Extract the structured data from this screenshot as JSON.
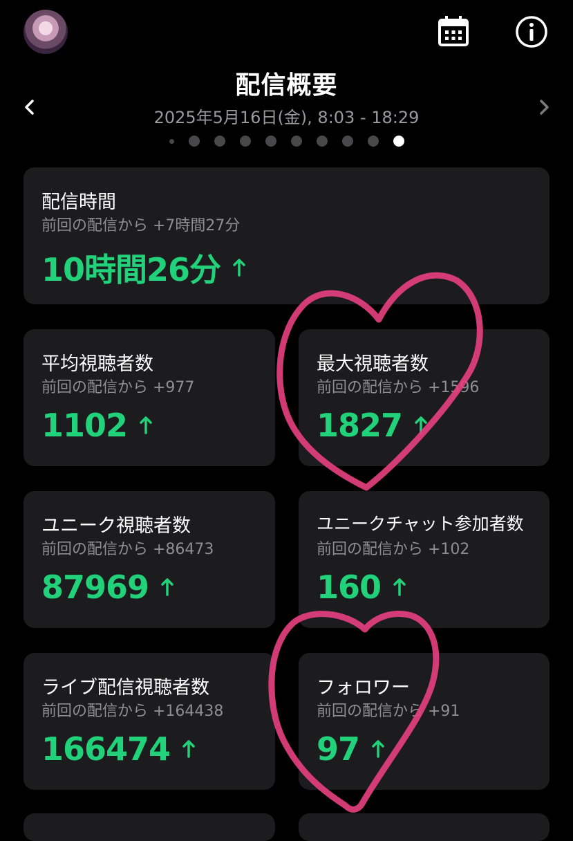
{
  "header": {
    "title": "配信概要",
    "date_range": "2025年5月16日(金), 8:03 - 18:29"
  },
  "icons": {
    "calendar": "calendar-icon",
    "info": "info-icon",
    "prev": "chevron-left-icon",
    "next": "chevron-right-icon",
    "trend": "arrow-up-icon"
  },
  "pager": {
    "count": 10,
    "active_index": 9
  },
  "colors": {
    "background": "#000000",
    "card": "#1c1c1e",
    "accent_green": "#22d27b",
    "annotation_pink": "#e8407f"
  },
  "cards": {
    "duration": {
      "label": "配信時間",
      "delta": "前回の配信から +7時間27分",
      "value": "10時間26分"
    },
    "avg_viewers": {
      "label": "平均視聴者数",
      "delta": "前回の配信から +977",
      "value": "1102"
    },
    "max_viewers": {
      "label": "最大視聴者数",
      "delta": "前回の配信から +1596",
      "value": "1827"
    },
    "unique_viewers": {
      "label": "ユニーク視聴者数",
      "delta": "前回の配信から +86473",
      "value": "87969"
    },
    "unique_chatters": {
      "label": "ユニークチャット参加者数",
      "delta": "前回の配信から +102",
      "value": "160"
    },
    "live_viewers": {
      "label": "ライブ配信視聴者数",
      "delta": "前回の配信から +164438",
      "value": "166474"
    },
    "followers": {
      "label": "フォロワー",
      "delta": "前回の配信から +91",
      "value": "97"
    }
  }
}
